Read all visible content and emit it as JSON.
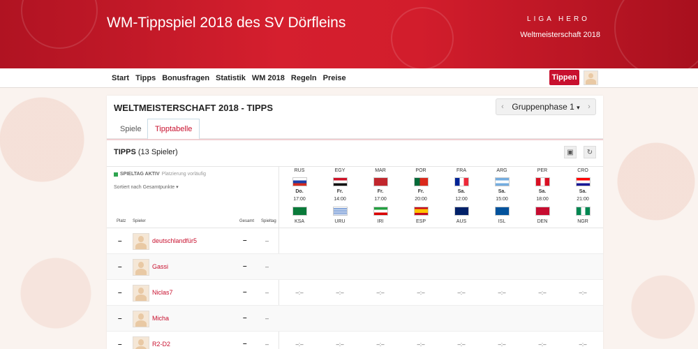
{
  "header": {
    "title": "WM-Tippspiel 2018 des SV Dörfleins",
    "brand": "LIGA HERO",
    "subtitle": "Weltmeisterschaft 2018"
  },
  "nav": {
    "items": [
      "Start",
      "Tipps",
      "Bonusfragen",
      "Statistik",
      "WM 2018",
      "Regeln",
      "Preise"
    ],
    "tippen": "Tippen"
  },
  "panel": {
    "title": "WELTMEISTERSCHAFT 2018 - TIPPS",
    "phase": "Gruppenphase 1",
    "phase_caret": "▾",
    "prev": "‹",
    "next": "›",
    "tabs": [
      "Spiele",
      "Tipptabelle"
    ],
    "tipps_label": "TIPPS",
    "tipps_count": "(13 Spieler)"
  },
  "table": {
    "status_bold": "SPIELTAG AKTIV",
    "status_rest": "Platzierung vorläufig",
    "sort": "Sortiert nach Gesamtpunkte ▾",
    "col_place": "Platz",
    "col_player": "Spieler",
    "col_total": "Gesamt",
    "col_day": "Spieltag",
    "matches": [
      {
        "home": "RUS",
        "away": "KSA",
        "day": "Do.",
        "time": "17:00"
      },
      {
        "home": "EGY",
        "away": "URU",
        "day": "Fr.",
        "time": "14:00"
      },
      {
        "home": "MAR",
        "away": "IRI",
        "day": "Fr.",
        "time": "17:00"
      },
      {
        "home": "POR",
        "away": "ESP",
        "day": "Fr.",
        "time": "20:00"
      },
      {
        "home": "FRA",
        "away": "AUS",
        "day": "Sa.",
        "time": "12:00"
      },
      {
        "home": "ARG",
        "away": "ISL",
        "day": "Sa.",
        "time": "15:00"
      },
      {
        "home": "PER",
        "away": "DEN",
        "day": "Sa.",
        "time": "18:00"
      },
      {
        "home": "CRO",
        "away": "NGR",
        "day": "Sa.",
        "time": "21:00"
      }
    ],
    "rows": [
      {
        "place": "–",
        "name": "deutschlandfür5",
        "total": "–",
        "day": "–",
        "tips": []
      },
      {
        "place": "–",
        "name": "Gassi",
        "total": "–",
        "day": "–",
        "tips": []
      },
      {
        "place": "–",
        "name": "Niclas7",
        "total": "–",
        "day": "–",
        "tips": [
          "–:–",
          "–:–",
          "–:–",
          "–:–",
          "–:–",
          "–:–",
          "–:–",
          "–:–"
        ]
      },
      {
        "place": "–",
        "name": "Micha",
        "total": "–",
        "day": "–",
        "tips": []
      },
      {
        "place": "–",
        "name": "R2-D2",
        "total": "–",
        "day": "–",
        "tips": [
          "–:–",
          "–:–",
          "–:–",
          "–:–",
          "–:–",
          "–:–",
          "–:–",
          "–:–"
        ]
      }
    ]
  }
}
